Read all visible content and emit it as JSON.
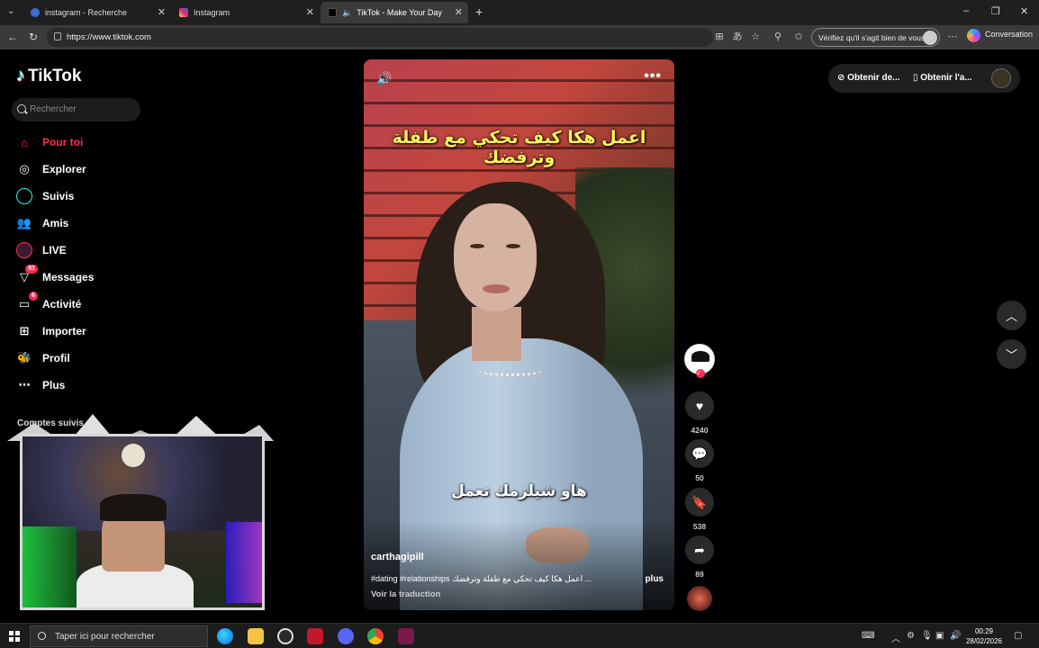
{
  "browser": {
    "tabs": [
      {
        "title": "instagram - Recherche",
        "active": false
      },
      {
        "title": "Instagram",
        "active": false
      },
      {
        "title": "TikTok - Make Your Day",
        "active": true
      }
    ],
    "url": "https://www.tiktok.com",
    "verify_label": "Vérifiez qu'il s'agit bien de vous",
    "copilot_label": "Conversation"
  },
  "sidebar": {
    "brand": "TikTok",
    "search_placeholder": "Rechercher",
    "items": [
      {
        "label": "Pour toi",
        "icon": "home-icon"
      },
      {
        "label": "Explorer",
        "icon": "compass-icon"
      },
      {
        "label": "Suivis",
        "icon": "following-icon"
      },
      {
        "label": "Amis",
        "icon": "friends-icon"
      },
      {
        "label": "LIVE",
        "icon": "live-icon"
      },
      {
        "label": "Messages",
        "icon": "messages-icon",
        "badge": "81"
      },
      {
        "label": "Activité",
        "icon": "activity-icon",
        "badge": "6"
      },
      {
        "label": "Importer",
        "icon": "upload-icon"
      },
      {
        "label": "Profil",
        "icon": "profile-icon"
      },
      {
        "label": "Plus",
        "icon": "more-icon"
      }
    ],
    "following_accounts_label": "Comptes suivis"
  },
  "video": {
    "subtitle_top": "اعمل هكا كيف تحكي مع طفلة وترفضك",
    "subtitle_mid": "هاو شيلزمك تعمل",
    "author": "carthagipill",
    "caption": "#dating #relationships اعمل هكا كيف تحكي مع طفلة وترفضك ...",
    "caption_more": "plus",
    "translate_label": "Voir la traduction"
  },
  "actions": {
    "likes": "4240",
    "comments": "50",
    "saves": "538",
    "shares": "89"
  },
  "topbar": {
    "get_coins": "Obtenir de...",
    "get_app": "Obtenir l'a..."
  },
  "taskbar": {
    "search_placeholder": "Taper ici pour rechercher",
    "time": "00:29",
    "date": "28/02/2026"
  },
  "colors": {
    "accent": "#fe2c55",
    "subtitle_yellow": "#fff45c"
  }
}
